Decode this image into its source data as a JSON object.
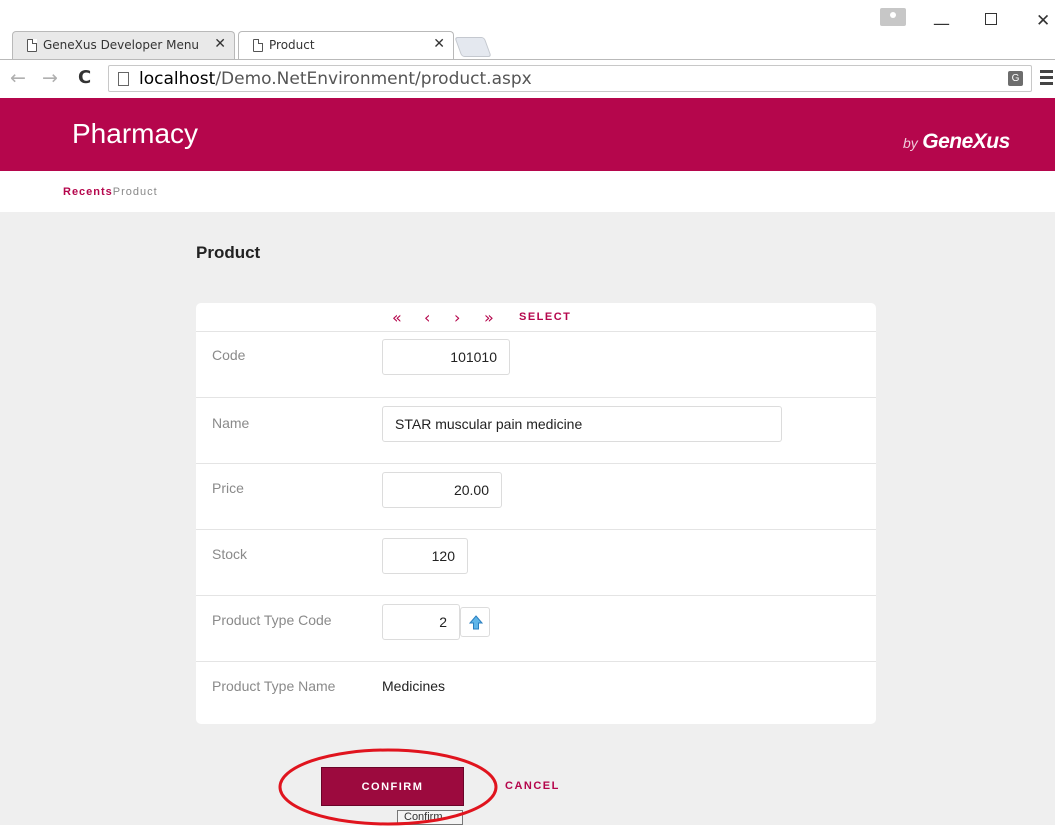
{
  "browser": {
    "tabs": [
      {
        "label": "GeneXus Developer Menu"
      },
      {
        "label": "Product"
      }
    ],
    "url_host": "localhost",
    "url_path": "/Demo.NetEnvironment/product.aspx"
  },
  "app": {
    "title": "Pharmacy",
    "brand_by": "by",
    "brand_name": "GeneXus",
    "accent_color": "#b5064c"
  },
  "breadcrumb": {
    "recents": "Recents",
    "current": "Product"
  },
  "page": {
    "title": "Product"
  },
  "pager": {
    "first": "«",
    "prev": "‹",
    "next": "›",
    "last": "»",
    "select": "SELECT"
  },
  "form": {
    "code_label": "Code",
    "code_value": "101010",
    "name_label": "Name",
    "name_value": "STAR muscular pain medicine",
    "price_label": "Price",
    "price_value": "20.00",
    "stock_label": "Stock",
    "stock_value": "120",
    "type_code_label": "Product Type Code",
    "type_code_value": "2",
    "type_name_label": "Product Type Name",
    "type_name_value": "Medicines"
  },
  "actions": {
    "confirm": "CONFIRM",
    "cancel": "CANCEL",
    "tooltip": "Confirm"
  }
}
